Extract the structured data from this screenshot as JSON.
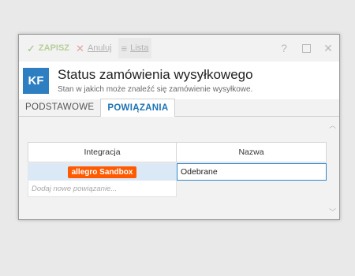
{
  "toolbar": {
    "save_label": "ZAPISZ",
    "cancel_label": "Anuluj",
    "list_label": "Lista",
    "help_label": "?"
  },
  "icons": {
    "save": "checkmark-icon",
    "cancel": "x-icon",
    "list": "list-icon",
    "help": "question-mark-icon",
    "maximize": "maximize-icon",
    "close": "close-icon"
  },
  "header": {
    "avatar_text": "KF",
    "title": "Status zamówienia wysyłkowego",
    "subtitle": "Stan w jakich może znaleźć się zamówienie wysyłkowe."
  },
  "tabs": [
    {
      "label": "PODSTAWOWE",
      "active": false
    },
    {
      "label": "POWIĄZANIA",
      "active": true
    }
  ],
  "grid": {
    "columns": [
      "Integracja",
      "Nazwa"
    ],
    "rows": [
      {
        "integration": "allegro Sandbox",
        "name": "Odebrane"
      }
    ],
    "add_placeholder": "Dodaj nowe powiązanie..."
  },
  "colors": {
    "accent": "#2d7fc1",
    "badge": "#ff5a00",
    "active_tab": "#1f74b6"
  }
}
